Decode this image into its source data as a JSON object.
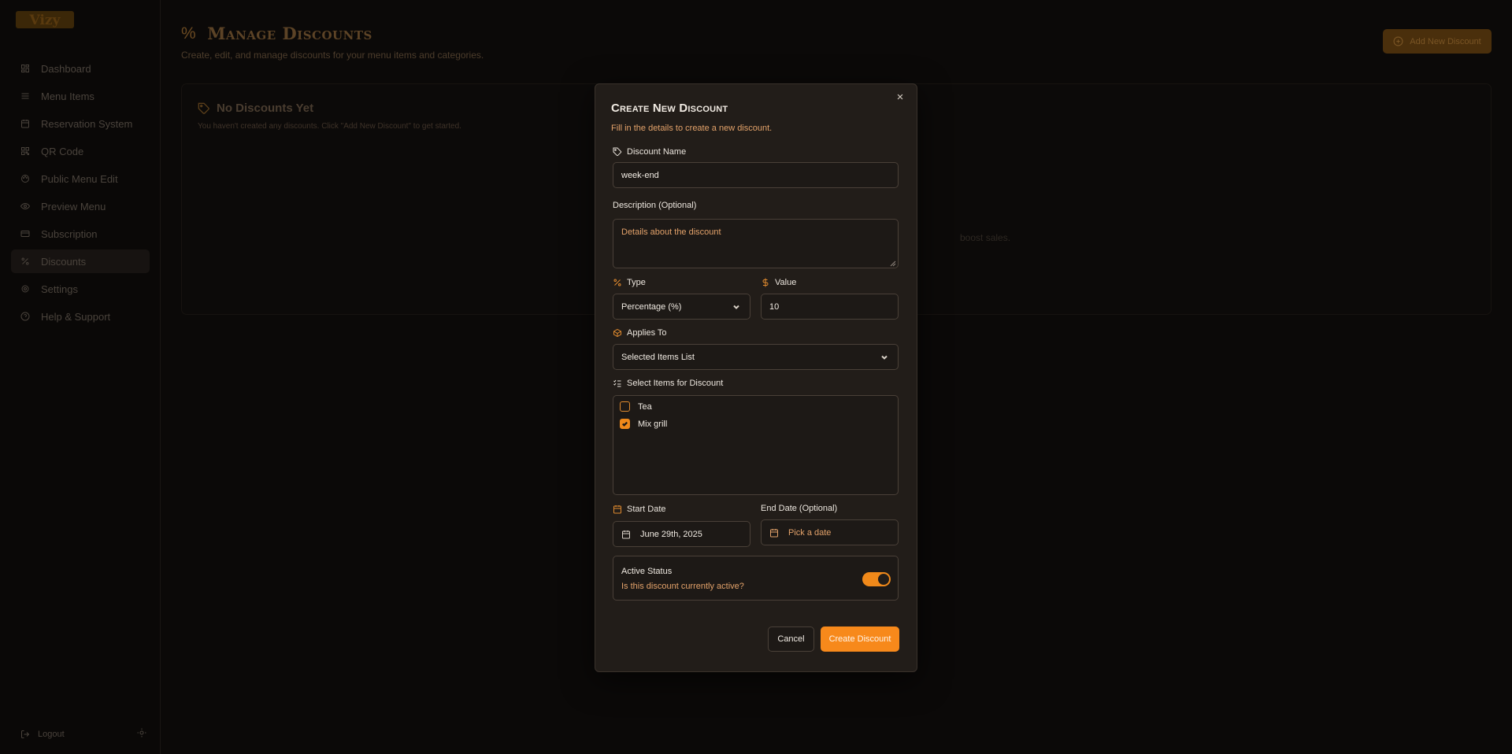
{
  "app": {
    "logo_text": "Vizy"
  },
  "sidebar": {
    "items": [
      {
        "label": "Dashboard",
        "icon": "dashboard-icon"
      },
      {
        "label": "Menu Items",
        "icon": "list-icon"
      },
      {
        "label": "Reservation System",
        "icon": "calendar-icon"
      },
      {
        "label": "QR Code",
        "icon": "qr-code-icon"
      },
      {
        "label": "Public Menu Edit",
        "icon": "palette-icon"
      },
      {
        "label": "Preview Menu",
        "icon": "eye-icon"
      },
      {
        "label": "Subscription",
        "icon": "credit-card-icon"
      },
      {
        "label": "Discounts",
        "icon": "percent-icon",
        "active": true
      },
      {
        "label": "Settings",
        "icon": "gear-icon"
      },
      {
        "label": "Help & Support",
        "icon": "help-circle-icon"
      }
    ],
    "logout_label": "Logout"
  },
  "page": {
    "title": "Manage Discounts",
    "subtitle": "Create, edit, and manage discounts for your menu items and categories.",
    "add_button_label": "Add New Discount",
    "empty_title": "No Discounts Yet",
    "empty_subtitle": "You haven't created any discounts. Click \"Add New Discount\" to get started.",
    "boost_text": "boost sales."
  },
  "modal": {
    "title": "Create New Discount",
    "subtitle": "Fill in the details to create a new discount.",
    "close_label": "×",
    "name_label": "Discount Name",
    "name_value": "week-end",
    "description_label": "Description (Optional)",
    "description_placeholder": "Details about the discount",
    "type_label": "Type",
    "type_value": "Percentage (%)",
    "value_label": "Value",
    "value_value": "10",
    "applies_label": "Applies To",
    "applies_value": "Selected Items List",
    "select_items_label": "Select Items for Discount",
    "items": [
      {
        "name": "Tea",
        "checked": false
      },
      {
        "name": "Mix grill",
        "checked": true
      }
    ],
    "start_date_label": "Start Date",
    "start_date_value": "June 29th, 2025",
    "end_date_label": "End Date (Optional)",
    "end_date_placeholder": "Pick a date",
    "status_title": "Active Status",
    "status_subtitle": "Is this discount currently active?",
    "status_active": true,
    "cancel_label": "Cancel",
    "create_label": "Create Discount"
  },
  "colors": {
    "accent": "#f7891b",
    "modal_bg": "#221d19",
    "page_bg": "#0b0908"
  }
}
